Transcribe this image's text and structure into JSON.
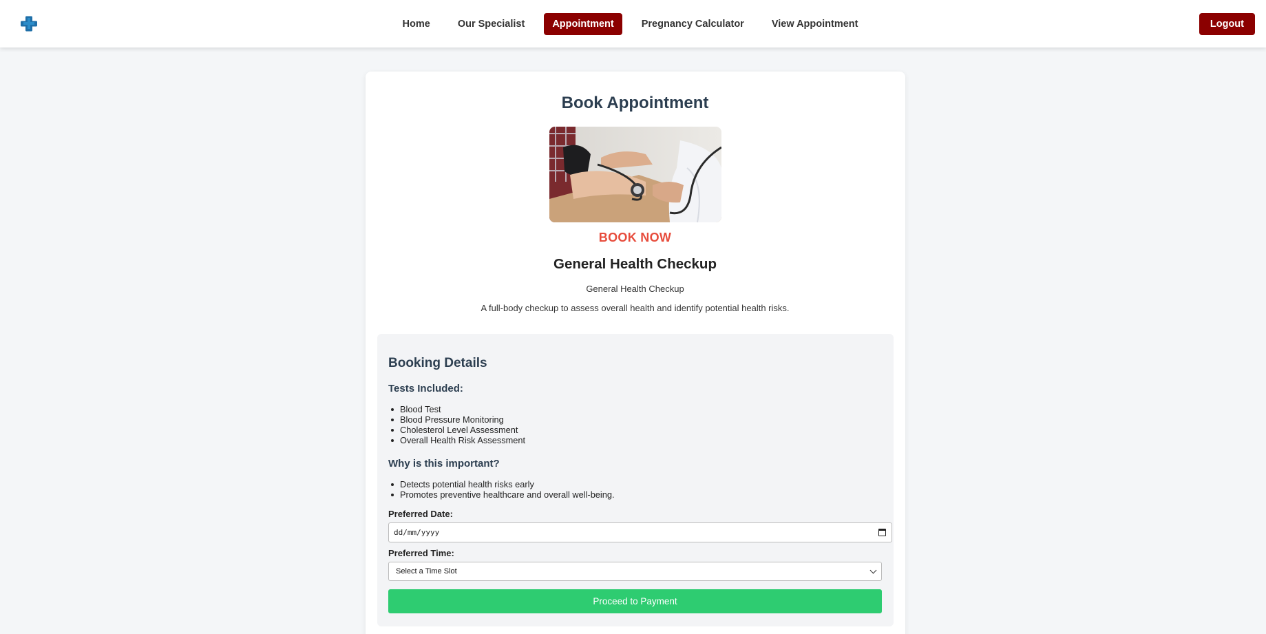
{
  "nav": {
    "logo_icon": "medical-cross-icon",
    "links": [
      "Home",
      "Our Specialist",
      "Appointment",
      "Pregnancy Calculator",
      "View Appointment"
    ],
    "active": "Appointment",
    "logout": "Logout"
  },
  "page": {
    "title": "Book Appointment",
    "image": "blood-pressure-measurement-photo",
    "book_now": "BOOK NOW",
    "service_title": "General Health Checkup",
    "service_subtitle": "General Health Checkup",
    "service_desc": "A full-body checkup to assess overall health and identify potential health risks."
  },
  "booking": {
    "title": "Booking Details",
    "tests_heading": "Tests Included:",
    "tests": [
      "Blood Test",
      "Blood Pressure Monitoring",
      "Cholesterol Level Assessment",
      "Overall Health Risk Assessment"
    ],
    "why_heading": "Why is this important?",
    "why": [
      "Detects potential health risks early",
      "Promotes preventive healthcare and overall well-being."
    ],
    "date_label": "Preferred Date:",
    "date_placeholder": "dd/mm/yyyy",
    "time_label": "Preferred Time:",
    "time_selected": "Select a Time Slot",
    "submit": "Proceed to Payment"
  },
  "colors": {
    "brand_red": "#8b0000",
    "accent_red": "#e74c3c",
    "cta_green": "#2ecc71",
    "logo_blue": "#2b7fb8"
  }
}
